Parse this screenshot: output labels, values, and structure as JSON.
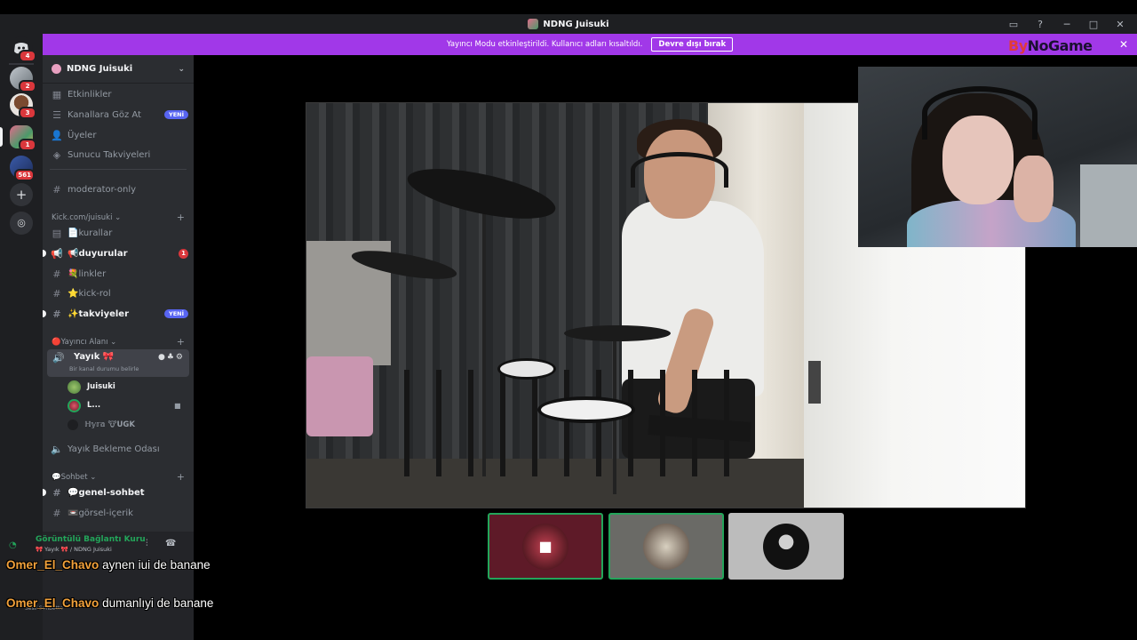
{
  "window": {
    "title": "NDNG Juisuki"
  },
  "banner": {
    "message": "Yayıncı Modu etkinleştirildi. Kullanıcı adları kısaltıldı.",
    "button": "Devre dışı bırak",
    "brand_prefix": "By",
    "brand_name": "NoGame"
  },
  "rail": {
    "servers": [
      {
        "name": "discord-home",
        "badge": "4"
      },
      {
        "name": "dm-1",
        "badge": "2"
      },
      {
        "name": "dm-2",
        "badge": "3"
      },
      {
        "name": "server-ndng",
        "badge": "1"
      },
      {
        "name": "server-4",
        "badge": "561"
      }
    ]
  },
  "sidebar": {
    "guild_name": "NDNG Juisuki",
    "items": [
      {
        "label": "Etkinlikler"
      },
      {
        "label": "Kanallara Göz At",
        "tag": "YENİ"
      },
      {
        "label": "Üyeler"
      },
      {
        "label": "Sunucu Takviyeleri"
      }
    ],
    "moderator_channel": "moderator-only",
    "cat_kick": "Kick.com/juisuki",
    "kick_channels": [
      {
        "label": "📄kurallar"
      },
      {
        "label": "📢duyurular",
        "badge": "1"
      },
      {
        "label": "💐linkler"
      },
      {
        "label": "⭐kick-rol"
      },
      {
        "label": "✨takviyeler",
        "tag": "YENİ"
      }
    ],
    "cat_yayinci": "🔴Yayıncı Alanı",
    "voice_channel": {
      "name": "Yayık 🎀",
      "status": "Bir kanal durumu belirle",
      "users": [
        {
          "name": "Juisuki"
        },
        {
          "name": "L..."
        },
        {
          "name": "ℍ𝕪𝕣𝕒  🐮UGK"
        }
      ]
    },
    "waiting_room": "Yayık Bekleme Odası",
    "cat_sohbet": "💬Sohbet",
    "sohbet_channels": [
      {
        "label": "💬genel-sohbet"
      },
      {
        "label": "📼görsel-içerik"
      }
    ]
  },
  "panel": {
    "connection": "Görüntülü Bağlantı Kuru",
    "connection_sub": "🎀 Yayık 🎀 / NDNG Juisuki",
    "user_status": "Sesli Sohbette"
  },
  "chat": [
    {
      "user": "Omer_El_Chavo",
      "message": "aynen iui de banane"
    },
    {
      "user": "Omer_El_Chavo",
      "message": "dumanlıyi de banane"
    }
  ],
  "colors": {
    "banner": "#a138e8",
    "sidebar": "#2b2d31",
    "rail": "#1e1f22",
    "speaking": "#23a55a",
    "chat_user": "#f2a13a",
    "new_tag": "#5865f2",
    "badge": "#da373c"
  }
}
